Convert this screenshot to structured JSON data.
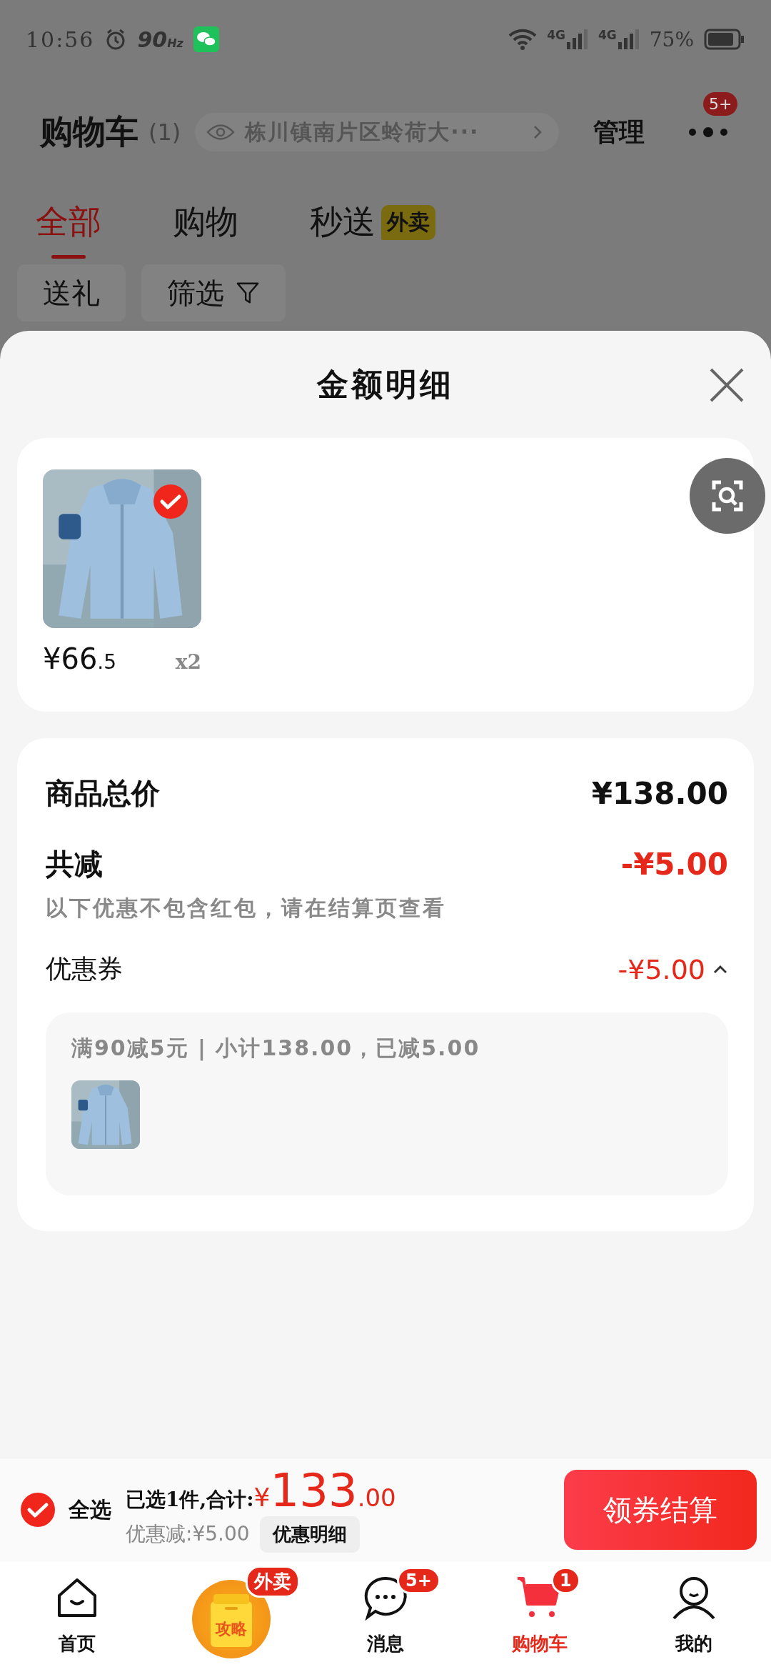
{
  "status_bar": {
    "time": "10:56",
    "refresh_rate": "90$_{Hz}$",
    "networks": [
      "4G",
      "4G"
    ],
    "battery": "75%"
  },
  "header": {
    "title": "购物车",
    "count": "(1)",
    "address": "栋川镇南片区蛉荷大···",
    "manage": "管理",
    "more_badge": "5+"
  },
  "tabs": [
    {
      "label": "全部",
      "selected": true
    },
    {
      "label": "购物",
      "selected": false
    },
    {
      "label": "秒送",
      "tag": "外卖",
      "selected": false
    }
  ],
  "chips": [
    {
      "label": "送礼",
      "kind": "plain"
    },
    {
      "label": "筛选",
      "kind": "filter"
    }
  ],
  "sheet": {
    "title": "金额明细",
    "products": [
      {
        "kind": "picture",
        "price": "¥66",
        "price_decimal": ".5",
        "quantity": "x2",
        "checked": true
      }
    ],
    "summary": {
      "total_label": "商品总价",
      "total_value": "¥138.00",
      "discount_label": "共减",
      "discount_value": "-¥5.00",
      "discount_note": "以下优惠不包含红包，请在结算页查看",
      "coupon_label": "优惠券",
      "coupon_value": "-¥5.00",
      "coupon_expanded": true,
      "coupon_detail": {
        "rule": "满90减5元 | 小计138.00，已减5.00"
      }
    }
  },
  "checkout_bar": {
    "select_all": {
      "label": "全选",
      "checked": true
    },
    "selected_text": "已选1件,合计:",
    "currency": "¥",
    "total": "133",
    "total_decimal": ".00",
    "discount": "优惠减:¥5.00",
    "details_button": "优惠明细",
    "checkout_button": "领券结算"
  },
  "nav": [
    {
      "kind": "home",
      "label": "首页",
      "selected": false
    },
    {
      "kind": "promo",
      "icon_text": "攻略",
      "badge": "外卖",
      "selected": false
    },
    {
      "kind": "message",
      "label": "消息",
      "badge": "5+",
      "selected": false
    },
    {
      "kind": "cart",
      "label": "购物车",
      "badge": "1",
      "selected": true
    },
    {
      "kind": "profile",
      "label": "我的",
      "selected": false
    }
  ]
}
